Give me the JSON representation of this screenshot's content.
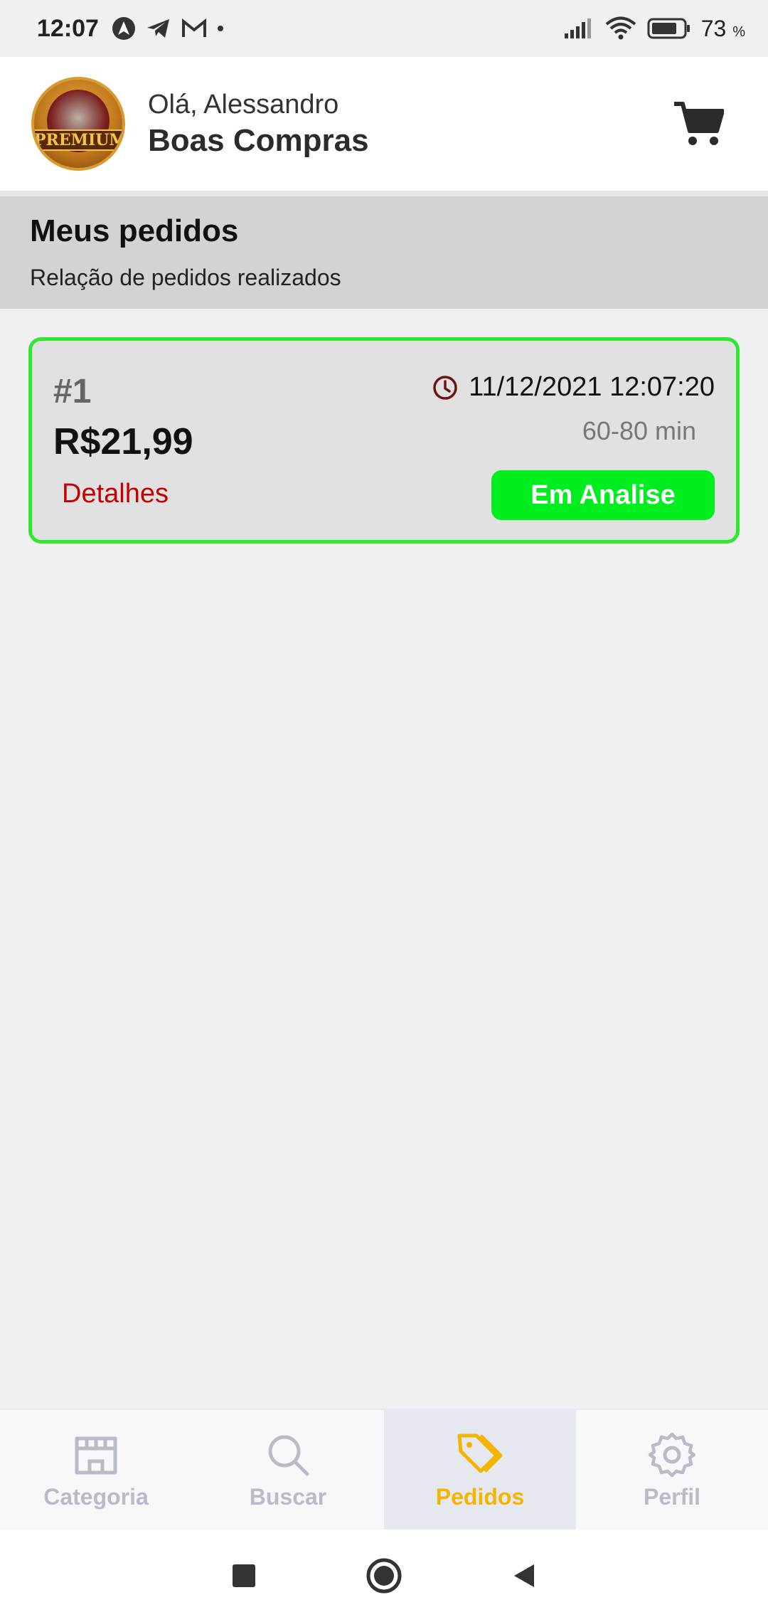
{
  "status_bar": {
    "time": "12:07",
    "battery_percent": "73",
    "battery_unit": "%",
    "icons_left": [
      "nav-arrow-icon",
      "telegram-icon",
      "gmail-icon",
      "dot-icon"
    ],
    "icons_right": [
      "signal-icon",
      "wifi-icon",
      "battery-icon"
    ]
  },
  "header": {
    "greeting": "Olá, Alessandro",
    "store_name": "Boas Compras",
    "logo_text": "PREMIUM",
    "cart_icon": "cart-icon"
  },
  "page": {
    "title": "Meus pedidos",
    "subtitle": "Relação de pedidos realizados"
  },
  "orders": [
    {
      "number": "#1",
      "total": "R$21,99",
      "details_label": "Detalhes",
      "datetime": "11/12/2021 12:07:20",
      "eta": "60-80 min",
      "status": "Em Analise",
      "status_color": "#00ee1e",
      "border_color": "#2ee82e"
    }
  ],
  "bottom_nav": {
    "active": "Pedidos",
    "active_color": "#f4b400",
    "inactive_color": "#b9bbc8",
    "items": [
      {
        "label": "Categoria",
        "icon": "store-icon"
      },
      {
        "label": "Buscar",
        "icon": "search-icon"
      },
      {
        "label": "Pedidos",
        "icon": "tag-icon"
      },
      {
        "label": "Perfil",
        "icon": "gear-icon"
      }
    ]
  },
  "system_nav": [
    "recents-icon",
    "home-icon",
    "back-icon"
  ]
}
